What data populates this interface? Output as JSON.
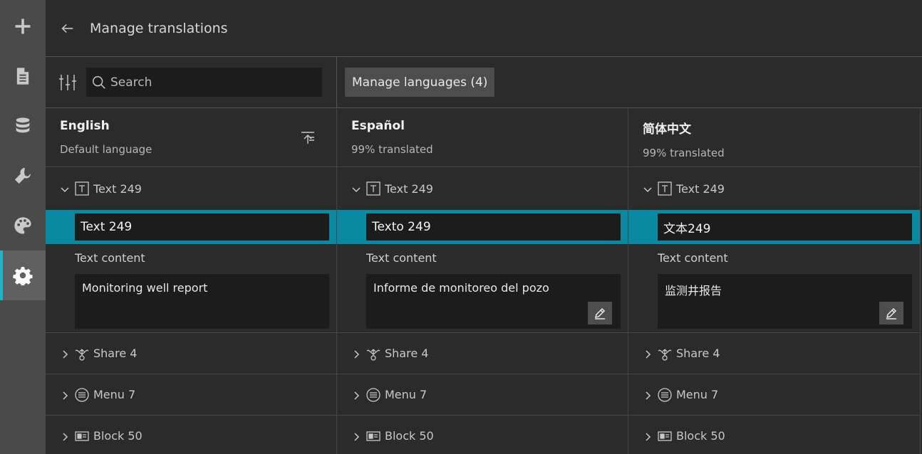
{
  "header": {
    "title": "Manage translations"
  },
  "toolbar": {
    "search_placeholder": "Search",
    "manage_languages_label": "Manage languages (4)"
  },
  "colors": {
    "accent": "#0a8aa0",
    "rail_active_bar": "#1fb2c9"
  },
  "rail": [
    {
      "icon": "plus-icon"
    },
    {
      "icon": "page-icon"
    },
    {
      "icon": "database-icon"
    },
    {
      "icon": "wrench-icon"
    },
    {
      "icon": "palette-icon"
    },
    {
      "icon": "gear-icon",
      "active": true
    }
  ],
  "columns": [
    {
      "name": "English",
      "subtitle": "Default language",
      "expanded_item": "Text 249",
      "item_value": "Text 249",
      "content_label": "Text content",
      "content_value": "Monitoring well report",
      "rows": [
        "Share 4",
        "Menu 7",
        "Block 50"
      ]
    },
    {
      "name": "Español",
      "subtitle": "99% translated",
      "expanded_item": "Text 249",
      "item_value": "Texto 249",
      "content_label": "Text content",
      "content_value": "Informe de monitoreo del pozo",
      "rows": [
        "Share 4",
        "Menu 7",
        "Block 50"
      ]
    },
    {
      "name": "简体中文",
      "subtitle": "99% translated",
      "expanded_item": "Text 249",
      "item_value": "文本249",
      "content_label": "Text content",
      "content_value": "监测井报告",
      "rows": [
        "Share 4",
        "Menu 7",
        "Block 50"
      ]
    }
  ]
}
